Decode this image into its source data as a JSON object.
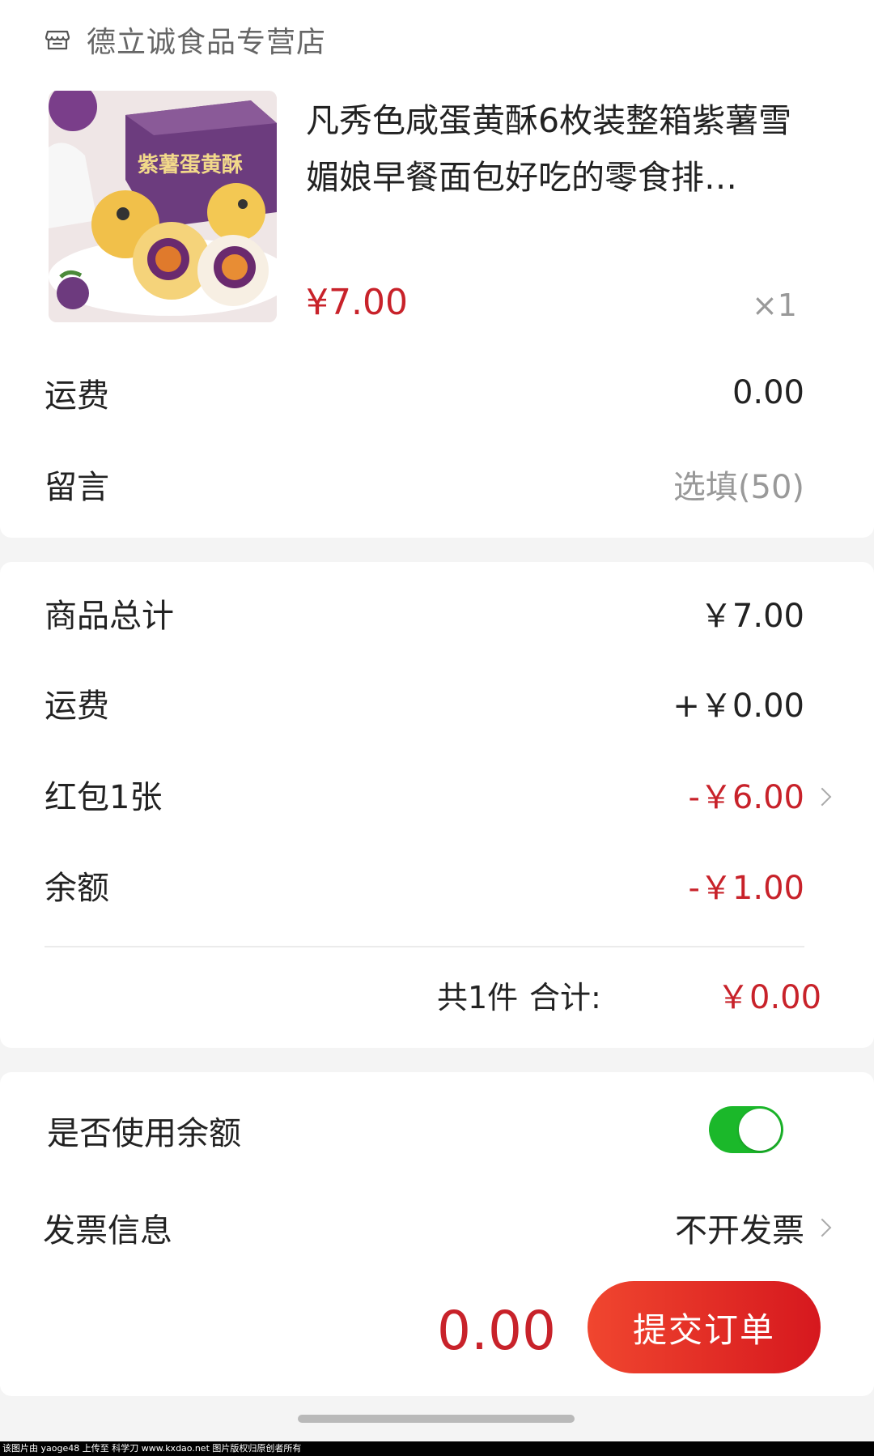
{
  "store": {
    "name": "德立诚食品专营店",
    "icon": "store-icon"
  },
  "product": {
    "title": "凡秀色咸蛋黄酥6枚装整箱紫薯雪媚娘早餐面包好吃的零食排…",
    "price": "¥7.00",
    "quantity": "×1",
    "image_box_text": "紫薯蛋黄酥"
  },
  "shipping_row": {
    "label": "运费",
    "value": "0.00"
  },
  "message_row": {
    "label": "留言",
    "placeholder": "选填(50)"
  },
  "totals": {
    "goods_total": {
      "label": "商品总计",
      "value": "￥7.00"
    },
    "shipping": {
      "label": "运费",
      "value": "+￥0.00"
    },
    "red_packet": {
      "label": "红包1张",
      "value": "-￥6.00"
    },
    "balance": {
      "label": "余额",
      "value": "-￥1.00"
    },
    "count_text": "共1件",
    "sum_label": "合计:",
    "sum_value": "￥0.00"
  },
  "use_balance": {
    "label": "是否使用余额",
    "enabled": true
  },
  "invoice": {
    "label": "发票信息",
    "value": "不开发票"
  },
  "footer": {
    "total": "0.00",
    "submit_label": "提交订单"
  },
  "watermark": "该图片由 yaoge48 上传至 科学刀 www.kxdao.net 图片版权归原创者所有",
  "colors": {
    "accent_red": "#c8222a",
    "toggle_green": "#1bb82a",
    "button_start": "#f0462f",
    "button_end": "#d6181e"
  }
}
